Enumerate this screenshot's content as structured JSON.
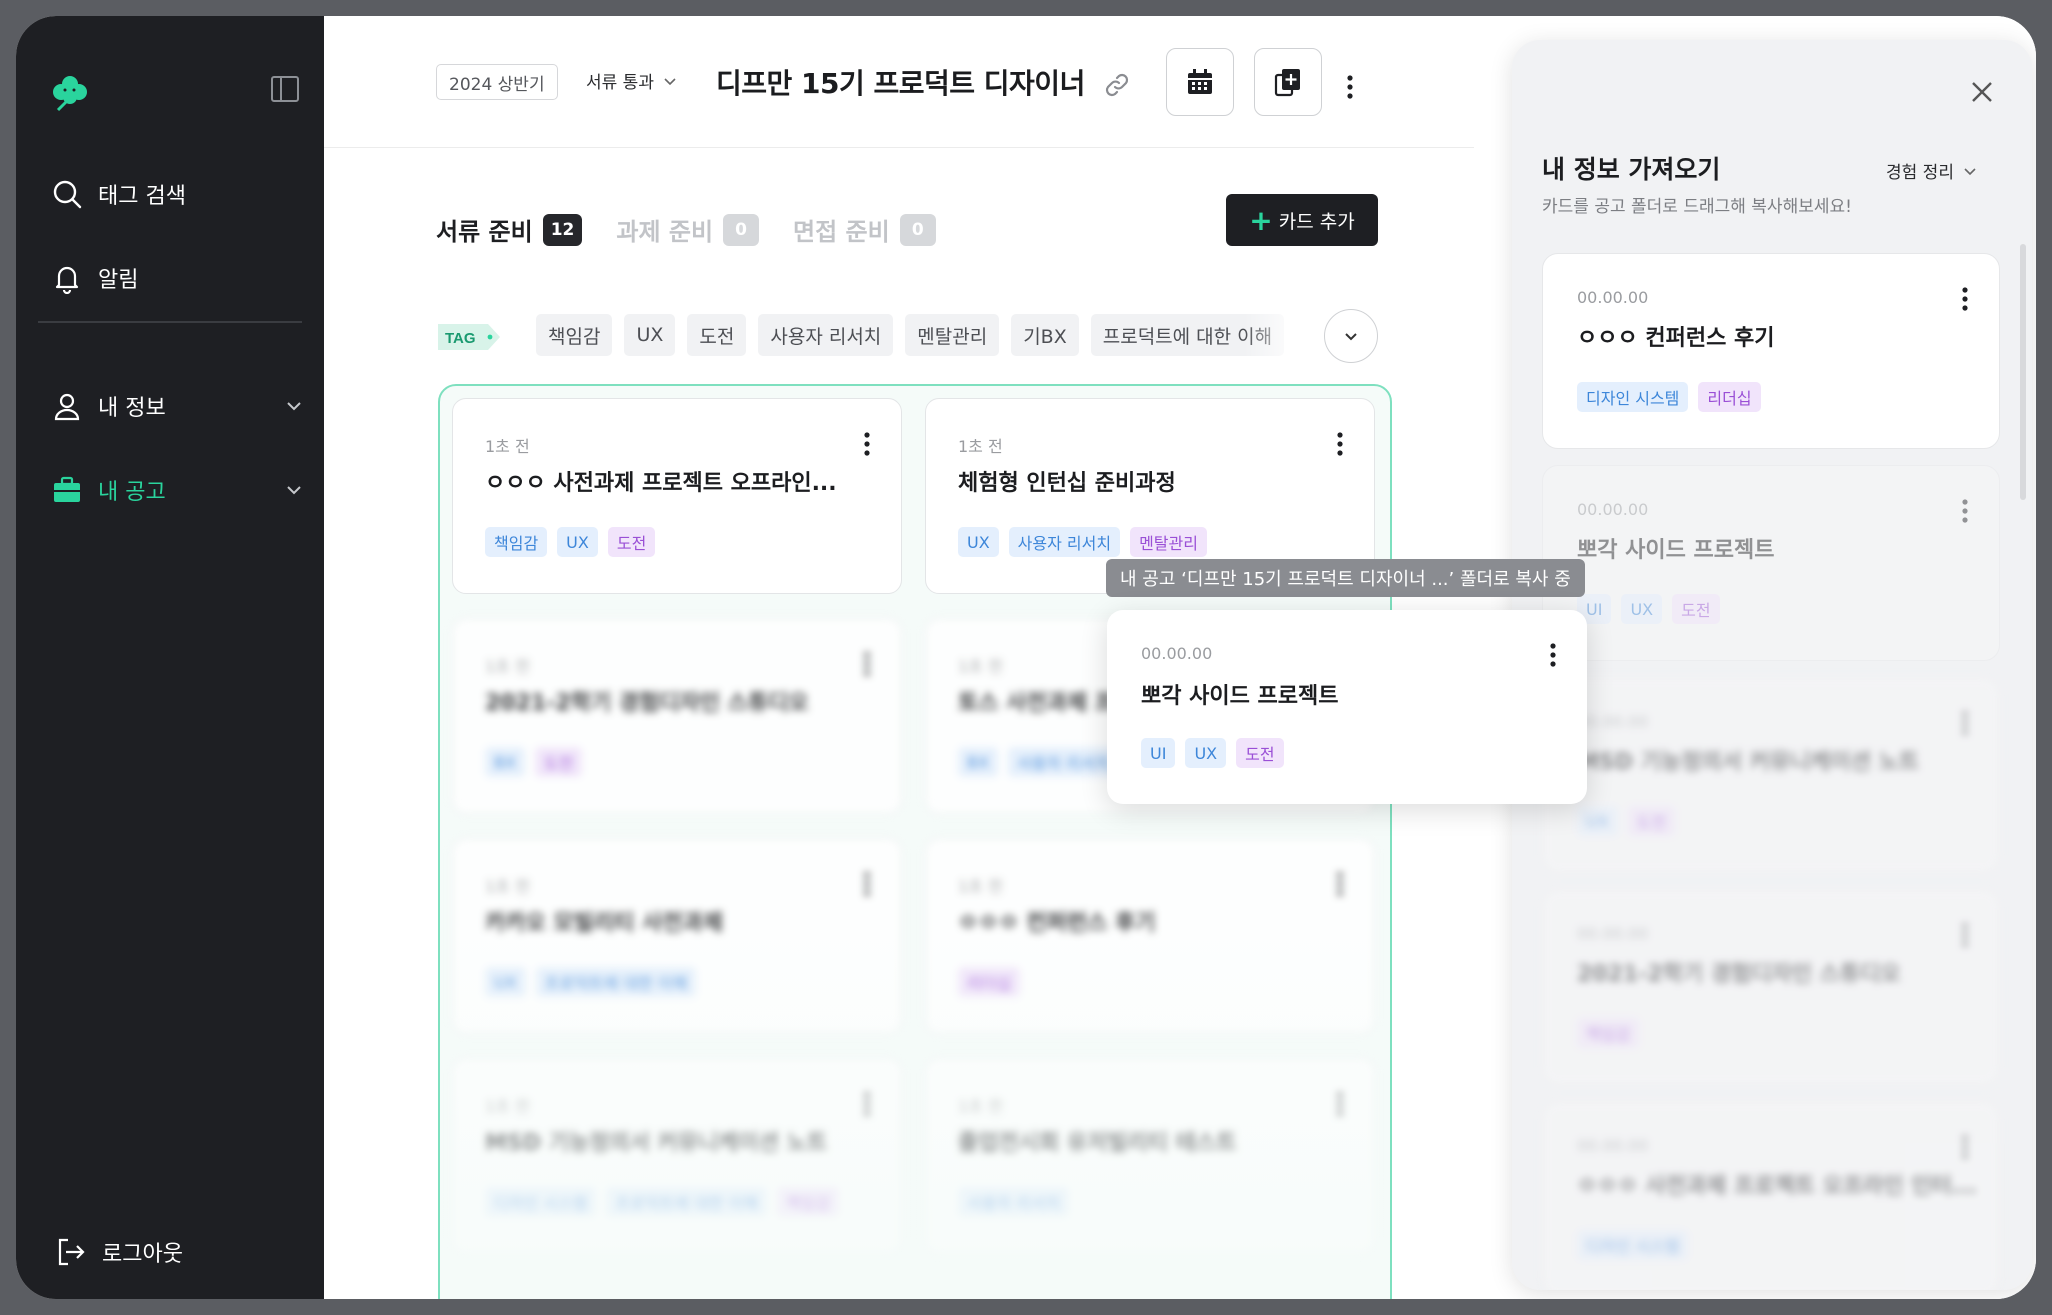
{
  "sidebar": {
    "items": [
      {
        "label": "태그 검색",
        "icon": "search-icon"
      },
      {
        "label": "알림",
        "icon": "bell-icon"
      },
      {
        "label": "내 정보",
        "icon": "user-icon"
      },
      {
        "label": "내 공고",
        "icon": "briefcase-icon"
      }
    ],
    "logout_label": "로그아웃",
    "accent": "#2ad49d"
  },
  "header": {
    "term": "2024 상반기",
    "stage": "서류 통과",
    "title": "디프만 15기 프로덕트 디자이너"
  },
  "tabs": [
    {
      "label": "서류 준비",
      "count": "12"
    },
    {
      "label": "과제 준비",
      "count": "0"
    },
    {
      "label": "면접 준비",
      "count": "0"
    }
  ],
  "add_card_label": "카드 추가",
  "tag_label": "TAG",
  "tags": [
    "책임감",
    "UX",
    "도전",
    "사용자 리서치",
    "멘탈관리",
    "기BX",
    "프로덕트에 대한 이해"
  ],
  "cards": [
    {
      "time": "1초 전",
      "title": "ㅇㅇㅇ 사전과제 프로젝트 오프라인...",
      "tags": [
        {
          "t": "책임감",
          "c": "blue"
        },
        {
          "t": "UX",
          "c": "blue"
        },
        {
          "t": "도전",
          "c": "purple"
        }
      ]
    },
    {
      "time": "1초 전",
      "title": "체험형 인턴십 준비과정",
      "tags": [
        {
          "t": "UX",
          "c": "blue"
        },
        {
          "t": "사용자 리서치",
          "c": "blue"
        },
        {
          "t": "멘탈관리",
          "c": "purple"
        }
      ]
    },
    {
      "time": "1초 전",
      "title": "2021-2학기 경험디자인 스튜디오",
      "tags": [
        {
          "t": "BX",
          "c": "blue"
        },
        {
          "t": "도전",
          "c": "purple"
        }
      ]
    },
    {
      "time": "1초 전",
      "title": "토스 사전과제 프로젝트",
      "tags": [
        {
          "t": "BX",
          "c": "blue"
        },
        {
          "t": "사용자 리서치",
          "c": "blue"
        }
      ]
    },
    {
      "time": "1초 전",
      "title": "카카오 모빌리티 사전과제",
      "tags": [
        {
          "t": "UX",
          "c": "blue"
        },
        {
          "t": "프로덕트에 대한 이해",
          "c": "blue"
        }
      ]
    },
    {
      "time": "1초 전",
      "title": "ㅇㅇㅇ 컨퍼런스 후기",
      "tags": [
        {
          "t": "리더십",
          "c": "purple"
        }
      ]
    },
    {
      "time": "1초 전",
      "title": "MSD 기능정의서 커뮤니케이션 노트",
      "tags": [
        {
          "t": "디자인 시스템",
          "c": "blue"
        },
        {
          "t": "프로덕트에 대한 이해",
          "c": "blue"
        },
        {
          "t": "책임감",
          "c": "purple"
        }
      ]
    },
    {
      "time": "1초 전",
      "title": "졸업전시회 유저빌리티 테스트",
      "tags": [
        {
          "t": "사용자 리서치",
          "c": "blue"
        }
      ]
    }
  ],
  "panel": {
    "title": "내 정보 가져오기",
    "subtitle": "카드를 공고 폴더로 드래그해 복사해보세요!",
    "filter": "경험 정리",
    "cards": [
      {
        "time": "00.00.00",
        "title": "ㅇㅇㅇ 컨퍼런스 후기",
        "tags": [
          {
            "t": "디자인 시스템",
            "c": "blue"
          },
          {
            "t": "리더십",
            "c": "purple"
          }
        ]
      },
      {
        "time": "00.00.00",
        "title": "뽀각 사이드 프로젝트",
        "tags": [
          {
            "t": "UI",
            "c": "blue"
          },
          {
            "t": "UX",
            "c": "blue"
          },
          {
            "t": "도전",
            "c": "purple"
          }
        ]
      },
      {
        "time": "00.00.00",
        "title": "MSD 기능정의서 커뮤니케이션 노트",
        "tags": [
          {
            "t": "UX",
            "c": "blue"
          },
          {
            "t": "도전",
            "c": "purple"
          }
        ]
      },
      {
        "time": "00.00.00",
        "title": "2021-2학기 경험디자인 스튜디오",
        "tags": [
          {
            "t": "책임감",
            "c": "purple"
          }
        ]
      },
      {
        "time": "00.00.00",
        "title": "ㅇㅇㅇ 사전과제 프로젝트 오프라인 인터...",
        "tags": [
          {
            "t": "디자인 시스템",
            "c": "blue"
          }
        ]
      }
    ]
  },
  "drag": {
    "tooltip": "내 공고 ‘디프만 15기 프로덕트 디자이너 ...’ 폴더로 복사 중",
    "card": {
      "time": "00.00.00",
      "title": "뽀각 사이드 프로젝트",
      "tags": [
        {
          "t": "UI",
          "c": "blue"
        },
        {
          "t": "UX",
          "c": "blue"
        },
        {
          "t": "도전",
          "c": "purple"
        }
      ]
    }
  }
}
